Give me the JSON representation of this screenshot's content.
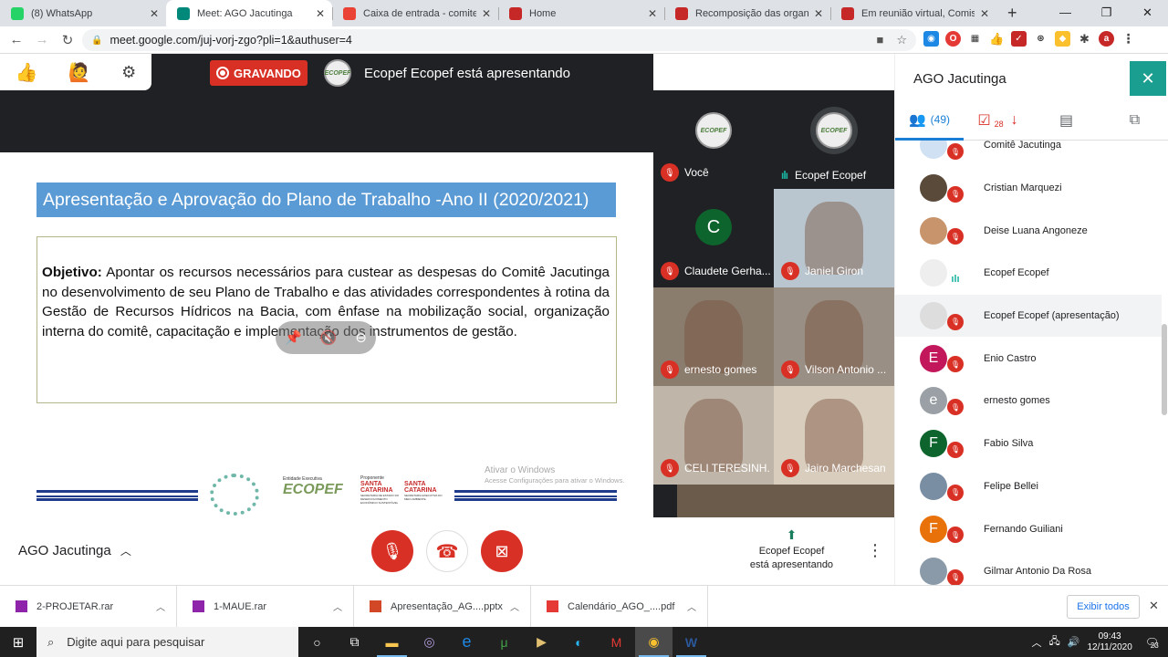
{
  "tabs": [
    {
      "title": "(8) WhatsApp",
      "fav_color": "#25d366",
      "fav_icon": "whatsapp-icon"
    },
    {
      "title": "Meet: AGO Jacutinga",
      "fav_color": "#00897b",
      "fav_icon": "meet-icon",
      "active": true
    },
    {
      "title": "Caixa de entrada - comitecha",
      "fav_color": "#ea4335",
      "fav_icon": "gmail-icon"
    },
    {
      "title": "Home",
      "fav_color": "#c62828",
      "fav_icon": "site-icon"
    },
    {
      "title": "Recomposição das organizaç",
      "fav_color": "#c62828",
      "fav_icon": "site-icon"
    },
    {
      "title": "Em reunião virtual, Comissão",
      "fav_color": "#c62828",
      "fav_icon": "site-icon"
    }
  ],
  "address": {
    "url": "meet.google.com/juj-vorj-zgo?pli=1&authuser=4"
  },
  "meet": {
    "recording_label": "GRAVANDO",
    "presenter_banner": "Ecopef Ecopef está apresentando",
    "logo_text": "ECOPEF"
  },
  "slide": {
    "title": "Apresentação e Aprovação do Plano de Trabalho -Ano II (2020/2021)",
    "objective_label": "Objetivo:",
    "objective_text": " Apontar os recursos necessários para custear as despesas do Comitê Jacutinga no desenvolvimento de seu Plano de Trabalho e das atividades correspondentes à rotina da Gestão de Recursos Hídricos na Bacia, com ênfase na mobilização social, organização interna do comitê, capacitação e implementação dos instrumentos de gestão.",
    "activate_title": "Ativar o Windows",
    "activate_sub": "Acesse Configurações para ativar o Windows.",
    "footer_entity_label": "Entidade Executiva",
    "footer_ecopef": "ECOPEF",
    "footer_proponent_label": "Proponente",
    "footer_sc1_title": "SANTA CATARINA",
    "footer_sc1_sub": "SECRETARIA DE ESTADO DO DESENVOLVIMENTO ECONÔMICO SUSTENTÁVEL",
    "footer_sc2_title": "SANTA CATARINA",
    "footer_sc2_sub": "SECRETARIA EXECUTIVA DO MEIO AMBIENTE"
  },
  "tiles": [
    {
      "name": "Você",
      "muted": true,
      "avatar": "logo"
    },
    {
      "name": "Ecopef Ecopef",
      "muted": false,
      "avatar": "logo"
    },
    {
      "name": "Claudete Gerha...",
      "muted": true,
      "avatar": "C",
      "avatar_color": "#0d652d"
    },
    {
      "name": "Janiel Giron",
      "muted": true,
      "avatar": "video",
      "bg": "#b9c6cf"
    },
    {
      "name": "ernesto gomes",
      "muted": true,
      "avatar": "video",
      "bg": "#8b7d6e"
    },
    {
      "name": "Vilson Antonio ...",
      "muted": true,
      "avatar": "video",
      "bg": "#9a8f84"
    },
    {
      "name": "CELI TERESINH...",
      "muted": true,
      "avatar": "video",
      "bg": "#bfb5a8"
    },
    {
      "name": "Jairo Marchesan",
      "muted": true,
      "avatar": "video",
      "bg": "#d9cdbd"
    }
  ],
  "sidebar": {
    "title": "AGO Jacutinga",
    "people_count": "(49)",
    "tasks_count": "28",
    "participants": [
      {
        "name": "Comitê Jacutinga",
        "initial": "",
        "color": "#cfe1f3",
        "mic": "muted"
      },
      {
        "name": "Cristian Marquezi",
        "initial": "",
        "color": "#5a4a3a",
        "mic": "muted"
      },
      {
        "name": "Deise Luana Angoneze",
        "initial": "",
        "color": "#c8946b",
        "mic": "muted"
      },
      {
        "name": "Ecopef Ecopef",
        "initial": "",
        "color": "#eeeeee",
        "mic": "speaking"
      },
      {
        "name": "Ecopef Ecopef (apresentação)",
        "initial": "",
        "color": "#dddddd",
        "mic": "muted",
        "highlight": true
      },
      {
        "name": "Enio Castro",
        "initial": "E",
        "color": "#c2185b",
        "mic": "muted"
      },
      {
        "name": "ernesto gomes",
        "initial": "e",
        "color": "#9aa0a6",
        "mic": "muted"
      },
      {
        "name": "Fabio Silva",
        "initial": "F",
        "color": "#0d652d",
        "mic": "muted"
      },
      {
        "name": "Felipe Bellei",
        "initial": "",
        "color": "#7a8ea3",
        "mic": "muted"
      },
      {
        "name": "Fernando Guiliani",
        "initial": "F",
        "color": "#e8710a",
        "mic": "muted"
      },
      {
        "name": "Gilmar Antonio Da Rosa",
        "initial": "",
        "color": "#8a9aa8",
        "mic": "muted"
      }
    ]
  },
  "bottom": {
    "meeting_name": "AGO Jacutinga",
    "presenting_line1": "Ecopef Ecopef",
    "presenting_line2": "está apresentando"
  },
  "downloads": [
    {
      "name": "2-PROJETAR.rar",
      "color": "#8e24aa"
    },
    {
      "name": "1-MAUE.rar",
      "color": "#8e24aa"
    },
    {
      "name": "Apresentação_AG....pptx",
      "color": "#d24726"
    },
    {
      "name": "Calendário_AGO_....pdf",
      "color": "#e53935"
    }
  ],
  "downloads_show_all": "Exibir todos",
  "taskbar": {
    "search_placeholder": "Digite aqui para pesquisar",
    "time": "09:43",
    "date": "12/11/2020",
    "notif_count": "23"
  }
}
